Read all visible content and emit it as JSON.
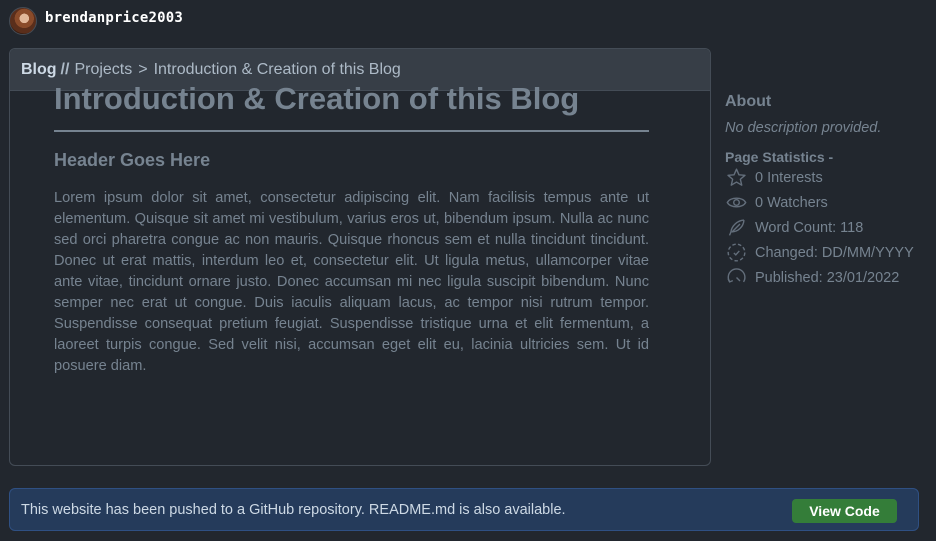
{
  "user": {
    "username": "brendanprice2003"
  },
  "breadcrumb": {
    "root": "Blog",
    "separator": "//",
    "section": "Projects",
    "arrow": ">",
    "current": "Introduction & Creation of this Blog"
  },
  "article": {
    "title": "Introduction & Creation of this Blog",
    "subheading": "Header Goes Here",
    "body": "Lorem ipsum dolor sit amet, consectetur adipiscing elit. Nam facilisis tempus ante ut elementum. Quisque sit amet mi vestibulum, varius eros ut, bibendum ipsum. Nulla ac nunc sed orci pharetra congue ac non mauris. Quisque rhoncus sem et nulla tincidunt tincidunt. Donec ut erat mattis, interdum leo et, consectetur elit. Ut ligula metus, ullamcorper vitae ante vitae, tincidunt ornare justo. Donec accumsan mi nec ligula suscipit bibendum. Nunc semper nec erat ut congue. Duis iaculis aliquam lacus, ac tempor nisi rutrum tempor. Suspendisse consequat pretium feugiat. Suspendisse tristique urna et elit fermentum, a laoreet turpis congue. Sed velit nisi, accumsan eget elit eu, lacinia ultricies sem. Ut id posuere diam."
  },
  "sidebar": {
    "about_title": "About",
    "about_desc": "No description provided.",
    "stats_title": "Page Statistics -",
    "stats": [
      {
        "icon": "star-icon",
        "label": "0 Interests"
      },
      {
        "icon": "eye-icon",
        "label": "0 Watchers"
      },
      {
        "icon": "feather-icon",
        "label": "Word Count: 118"
      },
      {
        "icon": "dashed-circle-icon",
        "label": "Changed: DD/MM/YYYY"
      },
      {
        "icon": "clock-arrow-icon",
        "label": "Published: 23/01/2022"
      }
    ]
  },
  "banner": {
    "text": "This website has been pushed to a GitHub repository. README.md is also available.",
    "button_label": "View Code"
  },
  "colors": {
    "background": "#22272e",
    "banner_bg": "#253b5b",
    "button_green": "#347d39",
    "muted_text": "#768390"
  }
}
